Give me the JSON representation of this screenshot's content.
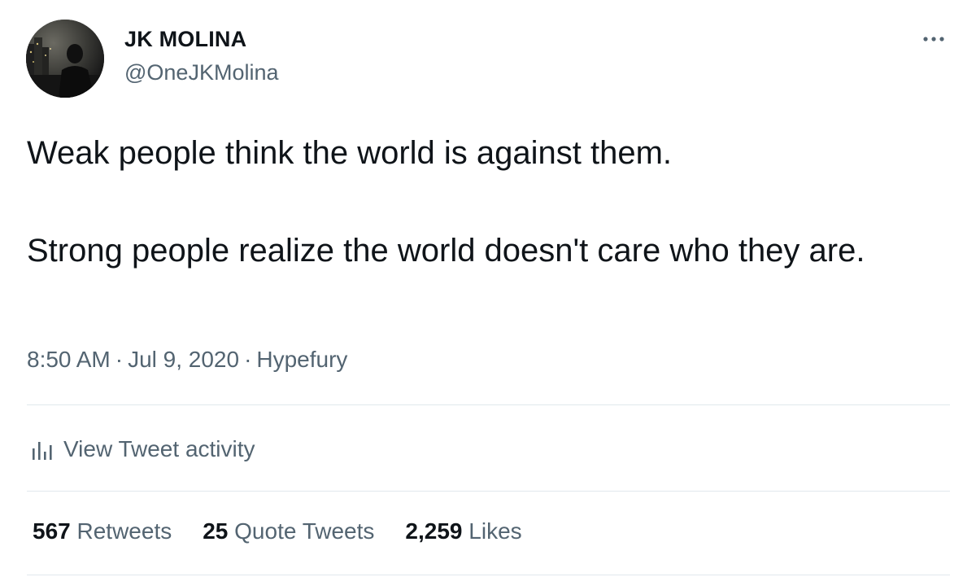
{
  "author": {
    "display_name": "JK MOLINA",
    "handle": "@OneJKMolina"
  },
  "tweet": {
    "paragraphs": [
      "Weak people think the world is against them.",
      "Strong people realize the world doesn't care who they are."
    ],
    "time": "8:50 AM",
    "date": "Jul 9, 2020",
    "source": "Hypefury",
    "separator": "·"
  },
  "activity": {
    "label": "View Tweet activity",
    "icon": "bar-chart-icon"
  },
  "stats": {
    "retweets": {
      "count": "567",
      "label": "Retweets"
    },
    "quotes": {
      "count": "25",
      "label": "Quote Tweets"
    },
    "likes": {
      "count": "2,259",
      "label": "Likes"
    }
  },
  "icons": {
    "more": "more-dots-icon"
  },
  "colors": {
    "primary_text": "#0f1419",
    "secondary_text": "#536471",
    "divider": "#e1e8ed"
  }
}
